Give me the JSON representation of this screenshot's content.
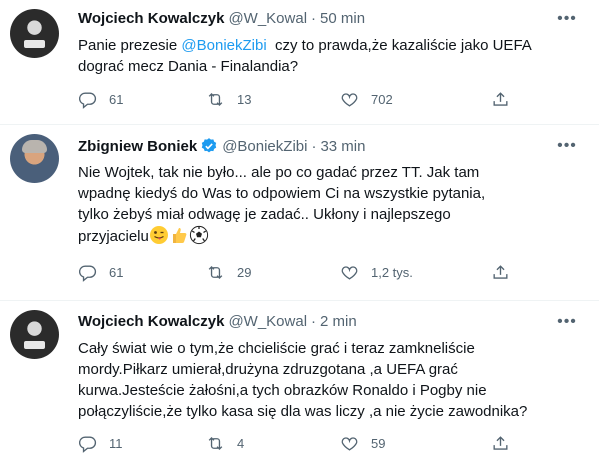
{
  "tweets": [
    {
      "name": "Wojciech Kowalczyk",
      "handle": "@W_Kowal",
      "time": "50 min",
      "text_before": "Panie prezesie ",
      "mention": "@BoniekZibi",
      "text_after": "  czy to prawda,że kazaliście jako UEFA\ndograć mecz Dania - Finalandia?",
      "replies": "61",
      "retweets": "13",
      "likes": "702"
    },
    {
      "name": "Zbigniew Boniek",
      "handle": "@BoniekZibi",
      "time": "33 min",
      "text": "Nie Wojtek, tak nie było... ale po co gadać przez TT. Jak tam\nwpadnę kiedyś do Was to odpowiem Ci na wszystkie pytania,\ntylko żebyś miał odwagę je zadać.. Ukłony i najlepszego\nprzyjacielu",
      "replies": "61",
      "retweets": "29",
      "likes": "1,2 tys."
    },
    {
      "name": "Wojciech Kowalczyk",
      "handle": "@W_Kowal",
      "time": "2 min",
      "text": "Cały świat wie o tym,że chcieliście grać i teraz zamkneliście\nmordy.Piłkarz umierał,drużyna zdruzgotana ,a UEFA grać\nkurwa.Jesteście żałośni,a tych obrazków Ronaldo i Pogby nie\npołączyliście,że tylko kasa się dla was liczy ,a nie życie zawodnika?",
      "replies": "11",
      "retweets": "4",
      "likes": "59"
    }
  ],
  "separator": "·",
  "icons": {
    "reply": "reply-icon",
    "retweet": "retweet-icon",
    "like": "heart-icon",
    "share": "share-icon",
    "more": "more-icon",
    "verified": "verified-badge-icon"
  },
  "colors": {
    "link": "#1d9bf0",
    "muted": "#536471",
    "verified": "#1d9bf0"
  }
}
